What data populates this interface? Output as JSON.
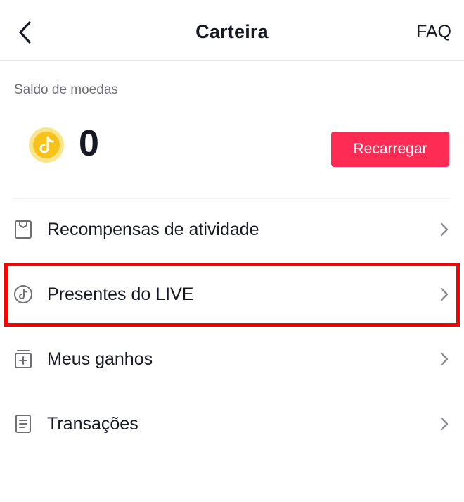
{
  "header": {
    "title": "Carteira",
    "faq_label": "FAQ"
  },
  "balance": {
    "label": "Saldo de moedas",
    "value": "0",
    "recharge_label": "Recarregar"
  },
  "menu": {
    "items": [
      {
        "label": "Recompensas de atividade",
        "icon": "gift-box-icon"
      },
      {
        "label": "Presentes do LIVE",
        "icon": "tiktok-circle-icon"
      },
      {
        "label": "Meus ganhos",
        "icon": "earnings-box-icon"
      },
      {
        "label": "Transações",
        "icon": "document-list-icon"
      }
    ]
  },
  "colors": {
    "accent": "#fe2c55",
    "highlight": "#ff0000",
    "coin": "#f7c31a"
  }
}
